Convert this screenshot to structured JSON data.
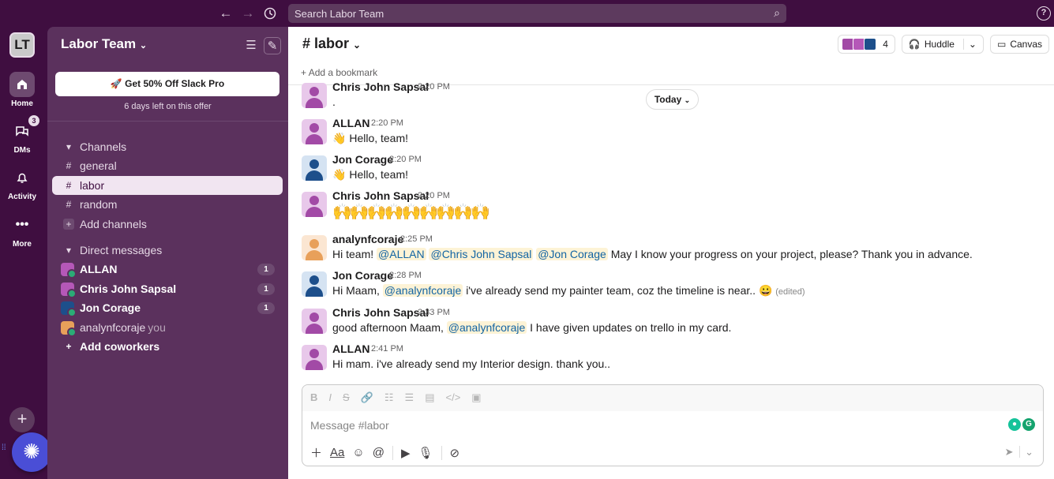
{
  "topbar": {
    "search_placeholder": "Search Labor Team",
    "help": "?"
  },
  "rail": {
    "workspace": "LT",
    "items": [
      {
        "label": "Home"
      },
      {
        "label": "DMs",
        "badge": "3"
      },
      {
        "label": "Activity"
      },
      {
        "label": "More"
      }
    ]
  },
  "sidebar": {
    "workspace_name": "Labor Team",
    "promo": {
      "button": "Get 50% Off Slack Pro",
      "sub": "6 days left on this offer"
    },
    "channels_header": "Channels",
    "channels": [
      {
        "name": "general"
      },
      {
        "name": "labor"
      },
      {
        "name": "random"
      }
    ],
    "add_channels": "Add channels",
    "dm_header": "Direct messages",
    "dms": [
      {
        "name": "ALLAN",
        "count": "1"
      },
      {
        "name": "Chris John Sapsal",
        "count": "1"
      },
      {
        "name": "Jon Corage",
        "count": "1"
      },
      {
        "name": "analynfcoraje",
        "suffix": "you"
      }
    ],
    "add_coworkers": "Add coworkers"
  },
  "channel": {
    "title": "# labor",
    "member_count": "4",
    "huddle": "Huddle",
    "canvas": "Canvas",
    "bookmark": "Add a bookmark",
    "today": "Today"
  },
  "messages": [
    {
      "author": "Chris John Sapsal",
      "time": "2:20 PM",
      "text": "."
    },
    {
      "author": "ALLAN",
      "time": "2:20 PM",
      "emoji": "👋",
      "text": "Hello, team!"
    },
    {
      "author": "Jon Corage",
      "time": "2:20 PM",
      "emoji": "👋",
      "text": "Hello, team!"
    },
    {
      "author": "Chris John Sapsal",
      "time": "2:20 PM",
      "text": "🙌🙌🙌🙌🙌🙌🙌🙌🙌"
    },
    {
      "author": "analynfcoraje",
      "time": "2:25 PM",
      "pre": "Hi team!",
      "m1": "@ALLAN",
      "m2": "@Chris John Sapsal",
      "m3": "@Jon Corage",
      "post": "May I know your progress on your project, please? Thank you in advance."
    },
    {
      "author": "Jon Corage",
      "time": "2:28 PM",
      "pre": "Hi Maam,",
      "m1": "@analynfcoraje",
      "post": "i've already send my painter team, coz the timeline is near..",
      "emoji": "😀",
      "edited": "(edited)"
    },
    {
      "author": "Chris John Sapsal",
      "time": "2:33 PM",
      "pre": "good afternoon Maam,",
      "m1": "@analynfcoraje",
      "post": "I have given updates on trello in my card."
    },
    {
      "author": "ALLAN",
      "time": "2:41 PM",
      "text": "Hi mam. i've already send my Interior design. thank you.."
    }
  ],
  "composer": {
    "placeholder": "Message #labor",
    "format_label": "Aa"
  },
  "colors": {
    "aubergine": "#3f0e40",
    "sidebar": "#5b315d",
    "mention_bg": "#fdf3d6",
    "mention_fg": "#1264a3"
  }
}
